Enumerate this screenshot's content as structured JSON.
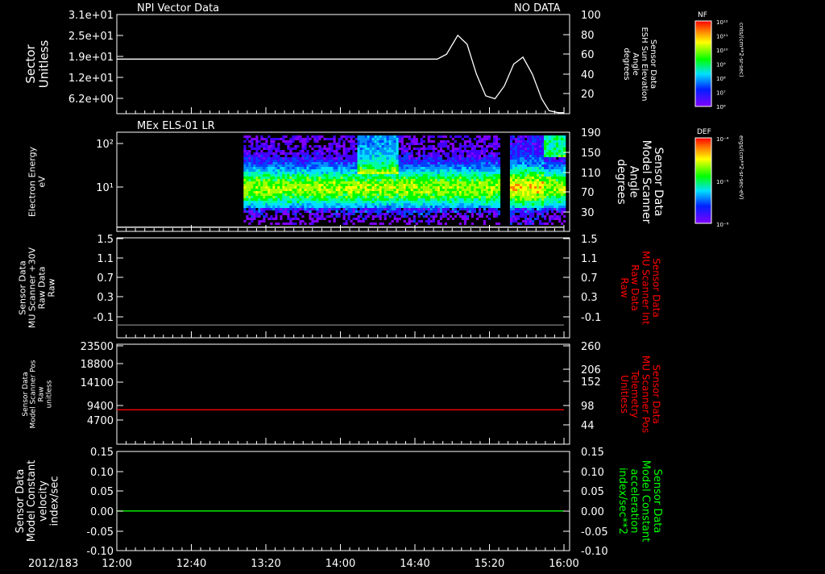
{
  "chart_data": [
    {
      "type": "line",
      "title": "NPI Vector Data",
      "status": "NO DATA",
      "ylabel_left": [
        "Sector",
        "Unitless"
      ],
      "yticks_left": [
        "3.1e+01",
        "2.5e+01",
        "1.9e+01",
        "1.2e+01",
        "6.2e+00"
      ],
      "ylabel_right": [
        "Sensor Data",
        "ESH Sun Elevation",
        "Angle",
        "degrees"
      ],
      "yticks_right": [
        "100",
        "80",
        "60",
        "40",
        "20"
      ],
      "ylim_right": [
        0,
        100
      ],
      "series": [
        {
          "name": "ESH Sun Elevation Angle",
          "color": "#ffffff",
          "x": [
            0,
            172,
            177,
            183,
            188,
            193,
            198,
            203,
            208,
            213,
            218,
            223,
            228,
            232,
            237,
            240
          ],
          "y": [
            55,
            55,
            60,
            79,
            70,
            40,
            18,
            15,
            28,
            50,
            57,
            40,
            15,
            3,
            1,
            1
          ]
        }
      ]
    },
    {
      "type": "heatmap",
      "title": "MEx ELS-01 LR",
      "ylabel_left": [
        "Electron Energy",
        "eV"
      ],
      "yticks_left": [
        "10²",
        "10¹"
      ],
      "ylabel_right": [
        "Sensor Data",
        "Model Scanner",
        "Angle",
        "degrees"
      ],
      "yticks_right": [
        "190",
        "150",
        "110",
        "70",
        "30"
      ],
      "ylim_right": [
        0,
        190
      ],
      "colorbar": {
        "label": "DEF",
        "ticks": [
          "10⁻⁴",
          "10⁻⁵",
          "10⁻⁶"
        ],
        "units": "ergs/(cm**2-sr-sec-eV)"
      },
      "series": [
        {
          "name": "Model Scanner Angle",
          "color": "#ffffff",
          "x": [
            0,
            240
          ],
          "y": [
            8,
            8
          ]
        }
      ]
    },
    {
      "type": "line",
      "ylabel_left": [
        "Sensor Data",
        "MU Scanner +30V",
        "Raw Data",
        "Raw"
      ],
      "yticks_left": [
        "1.5",
        "1.1",
        "0.7",
        "0.3",
        "-0.1"
      ],
      "ylabel_right": [
        "Sensor Data",
        "MU Scanner Int",
        "Raw Data",
        "Raw"
      ],
      "yticks_right": [
        "1.5",
        "1.1",
        "0.7",
        "0.3",
        "-0.1"
      ],
      "ylim": [
        -0.22,
        1.5
      ],
      "series": [
        {
          "name": "MU Scanner +30V",
          "color": "#808080",
          "x": [
            0,
            240
          ],
          "y": [
            0.0,
            0.0
          ]
        }
      ]
    },
    {
      "type": "line",
      "ylabel_left": [
        "Sensor Data",
        "Model Scanner Pos",
        "Raw",
        "unitless"
      ],
      "yticks_left": [
        "23500",
        "18800",
        "14100",
        "9400",
        "4700"
      ],
      "ylabel_right": [
        "Sensor Data",
        "MU Scanner Pos",
        "Telemetry",
        "Unitless"
      ],
      "yticks_right": [
        "260",
        "206",
        "152",
        "98",
        "44"
      ],
      "ylim": [
        0,
        23500
      ],
      "series": [
        {
          "name": "MU Scanner Pos",
          "color": "#ff0000",
          "x": [
            0,
            240
          ],
          "y": [
            8100,
            8100
          ]
        }
      ]
    },
    {
      "type": "line",
      "ylabel_left": [
        "Sensor Data",
        "Model Constant",
        "velocity",
        "index/sec"
      ],
      "yticks_left": [
        "0.15",
        "0.10",
        "0.05",
        "0.00",
        "-0.05",
        "-0.10"
      ],
      "ylabel_right": [
        "Sensor Data",
        "Model Constant",
        "acceleration",
        "index/sec**2"
      ],
      "yticks_right": [
        "0.15",
        "0.10",
        "0.05",
        "0.00",
        "-0.05",
        "-0.10"
      ],
      "ylim": [
        -0.1,
        0.15
      ],
      "series": [
        {
          "name": "Model Constant acceleration",
          "color": "#00ff00",
          "x": [
            0,
            240
          ],
          "y": [
            0,
            0
          ]
        }
      ]
    }
  ],
  "colorbar_nf": {
    "label": "NF",
    "ticks": [
      "10¹²",
      "10¹¹",
      "10¹⁰",
      "10⁹",
      "10⁸",
      "10⁷",
      "10⁶"
    ],
    "units": "cnts/(cm**2-sr-sec)"
  },
  "xaxis": {
    "date": "2012/183",
    "ticks": [
      "12:00",
      "12:40",
      "13:20",
      "14:00",
      "14:40",
      "15:20",
      "16:00"
    ]
  },
  "colors": {
    "right_label_panel3": "#ff0000",
    "right_label_panel4": "#ff0000",
    "right_label_panel5": "#00ff00"
  }
}
